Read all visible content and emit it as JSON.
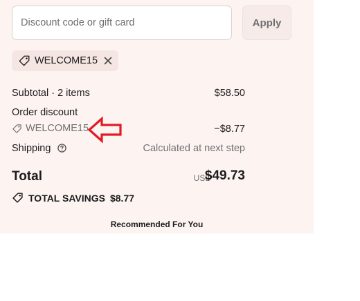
{
  "discount": {
    "placeholder": "Discount code or gift card",
    "value": "",
    "apply_label": "Apply"
  },
  "applied_code": {
    "code": "WELCOME15",
    "tag_icon": "tag-icon",
    "remove_icon": "close-icon"
  },
  "summary": {
    "subtotal_label": "Subtotal · 2 items",
    "subtotal_value": "$58.50",
    "order_discount_label": "Order discount",
    "discount_code": "WELCOME15",
    "discount_value": "−$8.77",
    "shipping_label": "Shipping",
    "shipping_value": "Calculated at next step"
  },
  "total": {
    "label": "Total",
    "currency": "USD",
    "value": "$49.73"
  },
  "savings": {
    "label": "TOTAL SAVINGS",
    "value": "$8.77"
  },
  "recommended_heading": "Recommended For You",
  "colors": {
    "panel_background": "#fdf4f2",
    "chip_background": "#f5e6e3",
    "annotation_red": "#e01b24"
  }
}
